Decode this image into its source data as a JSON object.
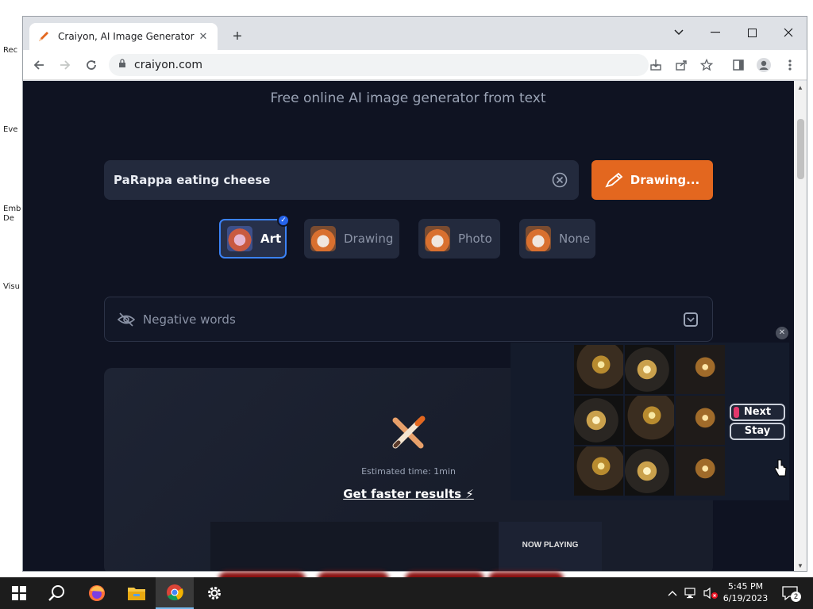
{
  "desktop": {
    "icons": [
      "Rec",
      "Eve",
      "Emb De",
      "Visu"
    ]
  },
  "browser": {
    "tab_title": "Craiyon, AI Image Generator",
    "url": "craiyon.com"
  },
  "page": {
    "subtitle": "Free online AI image generator from text",
    "search_value": "PaRappa eating cheese",
    "draw_button": "Drawing...",
    "styles": [
      {
        "label": "Art",
        "selected": true
      },
      {
        "label": "Drawing",
        "selected": false
      },
      {
        "label": "Photo",
        "selected": false
      },
      {
        "label": "None",
        "selected": false
      }
    ],
    "negative_words": "Negative words",
    "estimated_time": "Estimated time: 1min",
    "faster_link": "Get faster results ⚡",
    "now_playing": "NOW PLAYING"
  },
  "overlay": {
    "next": "Next",
    "stay": "Stay"
  },
  "taskbar": {
    "time": "5:45 PM",
    "date": "6/19/2023",
    "notification_count": "2"
  },
  "colors": {
    "accent": "#e3671f",
    "page_bg": "#0f1322",
    "selected_border": "#3b82f6"
  }
}
